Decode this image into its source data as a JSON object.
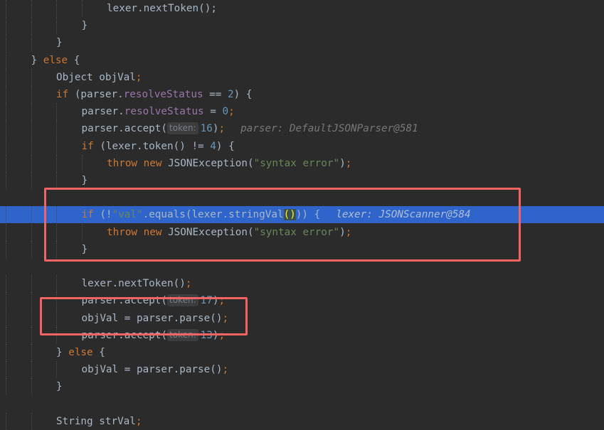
{
  "editor": {
    "language": "java",
    "lines": [
      {
        "indent": 4,
        "segments": [
          {
            "t": "lexer.nextToken();",
            "c": "plain"
          }
        ]
      },
      {
        "indent": 3,
        "segments": [
          {
            "t": "}",
            "c": "plain"
          }
        ]
      },
      {
        "indent": 2,
        "segments": [
          {
            "t": "}",
            "c": "plain"
          }
        ]
      },
      {
        "indent": 1,
        "segments": [
          {
            "t": "} ",
            "c": "plain"
          },
          {
            "t": "else",
            "c": "kw"
          },
          {
            "t": " {",
            "c": "plain"
          }
        ]
      },
      {
        "indent": 2,
        "segments": [
          {
            "t": "Object objVal",
            "c": "plain"
          },
          {
            "t": ";",
            "c": "kw"
          }
        ]
      },
      {
        "indent": 2,
        "segments": [
          {
            "t": "if",
            "c": "kw"
          },
          {
            "t": " (parser.",
            "c": "plain"
          },
          {
            "t": "resolveStatus",
            "c": "fld"
          },
          {
            "t": " == ",
            "c": "plain"
          },
          {
            "t": "2",
            "c": "num"
          },
          {
            "t": ") {",
            "c": "plain"
          }
        ]
      },
      {
        "indent": 3,
        "segments": [
          {
            "t": "parser.",
            "c": "plain"
          },
          {
            "t": "resolveStatus",
            "c": "fld"
          },
          {
            "t": " = ",
            "c": "plain"
          },
          {
            "t": "0",
            "c": "num"
          },
          {
            "t": ";",
            "c": "kw"
          }
        ]
      },
      {
        "indent": 3,
        "segments": [
          {
            "t": "parser.accept(",
            "c": "plain"
          },
          {
            "t": "token:",
            "c": "hint"
          },
          {
            "t": "16",
            "c": "num"
          },
          {
            "t": ")",
            "c": "plain"
          },
          {
            "t": ";",
            "c": "kw"
          }
        ],
        "inline_value": "parser: DefaultJSONParser@581"
      },
      {
        "indent": 3,
        "segments": [
          {
            "t": "if",
            "c": "kw"
          },
          {
            "t": " (lexer.token() != ",
            "c": "plain"
          },
          {
            "t": "4",
            "c": "num"
          },
          {
            "t": ") {",
            "c": "plain"
          }
        ]
      },
      {
        "indent": 4,
        "segments": [
          {
            "t": "throw new",
            "c": "kw"
          },
          {
            "t": " JSONException(",
            "c": "plain"
          },
          {
            "t": "\"syntax error\"",
            "c": "str"
          },
          {
            "t": ")",
            "c": "plain"
          },
          {
            "t": ";",
            "c": "kw"
          }
        ]
      },
      {
        "indent": 3,
        "segments": [
          {
            "t": "}",
            "c": "plain"
          }
        ]
      },
      {
        "indent": 0,
        "segments": []
      },
      {
        "indent": 3,
        "current": true,
        "segments": [
          {
            "t": "if",
            "c": "kw"
          },
          {
            "t": " (!",
            "c": "plain"
          },
          {
            "t": "\"val\"",
            "c": "str"
          },
          {
            "t": ".equals(lexer.stringVal",
            "c": "plain"
          },
          {
            "t": "()",
            "c": "paren-hl"
          },
          {
            "t": ")) {",
            "c": "plain"
          }
        ],
        "inline_value": "lexer: JSONScanner@584"
      },
      {
        "indent": 4,
        "segments": [
          {
            "t": "throw new",
            "c": "kw"
          },
          {
            "t": " JSONException(",
            "c": "plain"
          },
          {
            "t": "\"syntax error\"",
            "c": "str"
          },
          {
            "t": ")",
            "c": "plain"
          },
          {
            "t": ";",
            "c": "kw"
          }
        ]
      },
      {
        "indent": 3,
        "segments": [
          {
            "t": "}",
            "c": "plain"
          }
        ]
      },
      {
        "indent": 0,
        "segments": []
      },
      {
        "indent": 3,
        "segments": [
          {
            "t": "lexer.nextToken()",
            "c": "plain"
          },
          {
            "t": ";",
            "c": "kw"
          }
        ]
      },
      {
        "indent": 3,
        "segments": [
          {
            "t": "parser.accept(",
            "c": "plain"
          },
          {
            "t": "token:",
            "c": "hint"
          },
          {
            "t": "17",
            "c": "num"
          },
          {
            "t": ")",
            "c": "plain"
          },
          {
            "t": ";",
            "c": "kw"
          }
        ]
      },
      {
        "indent": 3,
        "segments": [
          {
            "t": "objVal = parser.parse()",
            "c": "plain"
          },
          {
            "t": ";",
            "c": "kw"
          }
        ]
      },
      {
        "indent": 3,
        "segments": [
          {
            "t": "parser.accept(",
            "c": "plain"
          },
          {
            "t": "token:",
            "c": "hint"
          },
          {
            "t": "13",
            "c": "num"
          },
          {
            "t": ")",
            "c": "plain"
          },
          {
            "t": ";",
            "c": "kw"
          }
        ]
      },
      {
        "indent": 2,
        "segments": [
          {
            "t": "} ",
            "c": "plain"
          },
          {
            "t": "else",
            "c": "kw"
          },
          {
            "t": " {",
            "c": "plain"
          }
        ]
      },
      {
        "indent": 3,
        "segments": [
          {
            "t": "objVal = parser.parse()",
            "c": "plain"
          },
          {
            "t": ";",
            "c": "kw"
          }
        ]
      },
      {
        "indent": 2,
        "segments": [
          {
            "t": "}",
            "c": "plain"
          }
        ]
      },
      {
        "indent": 0,
        "segments": []
      },
      {
        "indent": 2,
        "segments": [
          {
            "t": "String strVal",
            "c": "plain"
          },
          {
            "t": ";",
            "c": "kw"
          }
        ]
      }
    ]
  },
  "colors": {
    "background": "#2b2b2b",
    "current_line": "#2f65ca",
    "keyword": "#cc7832",
    "field": "#9876aa",
    "number": "#6897bb",
    "string": "#6a8759",
    "annotation_box": "#f26363"
  }
}
